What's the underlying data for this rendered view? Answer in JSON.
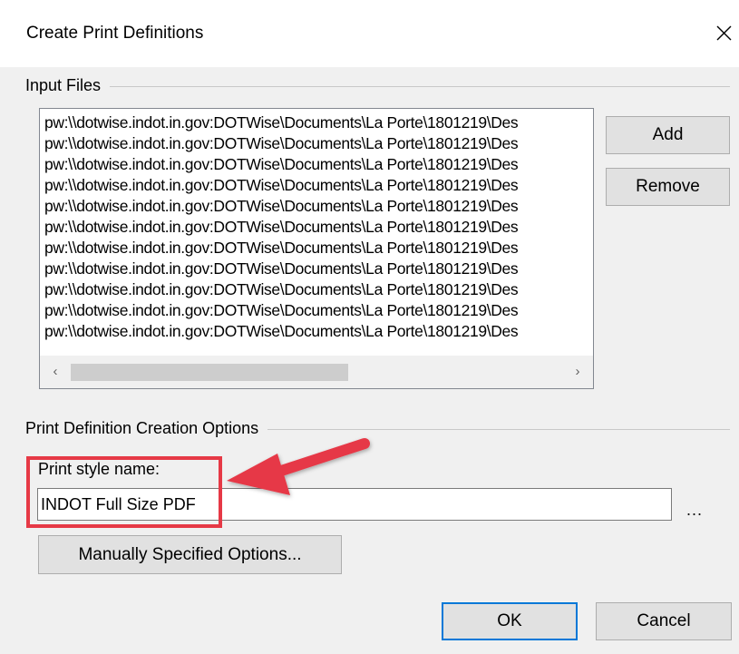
{
  "dialog": {
    "title": "Create Print Definitions"
  },
  "input_files": {
    "group_label": "Input Files",
    "files": [
      "pw:\\\\dotwise.indot.in.gov:DOTWise\\Documents\\La Porte\\1801219\\Des",
      "pw:\\\\dotwise.indot.in.gov:DOTWise\\Documents\\La Porte\\1801219\\Des",
      "pw:\\\\dotwise.indot.in.gov:DOTWise\\Documents\\La Porte\\1801219\\Des",
      "pw:\\\\dotwise.indot.in.gov:DOTWise\\Documents\\La Porte\\1801219\\Des",
      "pw:\\\\dotwise.indot.in.gov:DOTWise\\Documents\\La Porte\\1801219\\Des",
      "pw:\\\\dotwise.indot.in.gov:DOTWise\\Documents\\La Porte\\1801219\\Des",
      "pw:\\\\dotwise.indot.in.gov:DOTWise\\Documents\\La Porte\\1801219\\Des",
      "pw:\\\\dotwise.indot.in.gov:DOTWise\\Documents\\La Porte\\1801219\\Des",
      "pw:\\\\dotwise.indot.in.gov:DOTWise\\Documents\\La Porte\\1801219\\Des",
      "pw:\\\\dotwise.indot.in.gov:DOTWise\\Documents\\La Porte\\1801219\\Des",
      "pw:\\\\dotwise.indot.in.gov:DOTWise\\Documents\\La Porte\\1801219\\Des"
    ],
    "add_label": "Add",
    "remove_label": "Remove",
    "scroll_left": "‹",
    "scroll_right": "›"
  },
  "options": {
    "group_label": "Print Definition Creation Options",
    "print_style_label": "Print style name:",
    "print_style_value": "INDOT Full Size PDF",
    "browse_label": "...",
    "manual_options_label": "Manually Specified Options..."
  },
  "footer": {
    "ok_label": "OK",
    "cancel_label": "Cancel"
  },
  "annotation": {
    "highlight_color": "#e63946"
  }
}
